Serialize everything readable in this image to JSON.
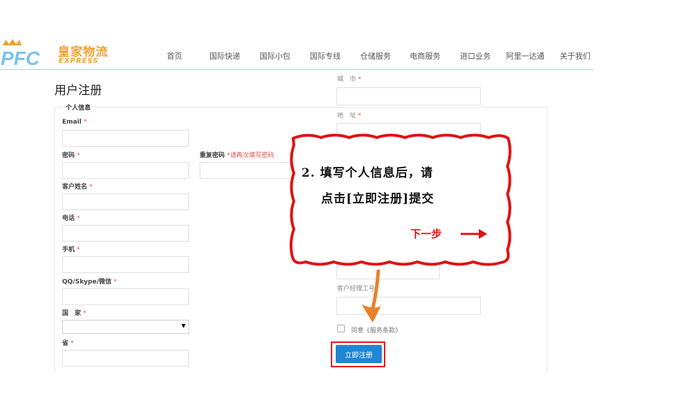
{
  "header": {
    "logo_mark": "PFC",
    "logo_text": "皇家物流",
    "logo_sub": "EXPRESS",
    "nav": [
      "首页",
      "国际快递",
      "国际小包",
      "国际专线",
      "仓储服务",
      "电商服务",
      "进口业务",
      "阿里一达通",
      "关于我们"
    ]
  },
  "page": {
    "title": "用户注册",
    "section_title": "个人信息"
  },
  "form": {
    "required_mark": "*",
    "email_label": "Email",
    "password_label": "密码",
    "confirm_password_label": "重复密码",
    "confirm_password_hint": "*请再次填写密码",
    "name_label": "客户姓名",
    "phone_label": "电话",
    "mobile_label": "手机",
    "im_label": "QQ/Skype/微信",
    "country_label": "国　家",
    "province_label": "省",
    "city_label": "城　市",
    "address_label": "地　址",
    "manager_label": "客户经理工号",
    "agree_text": "同意《服务条款》",
    "submit_label": "立即注册"
  },
  "callout": {
    "line1": "2. 填写个人信息后，请",
    "line2": "点击[立即注册]提交",
    "next": "下一步"
  },
  "colors": {
    "accent": "#f0a030",
    "logo_blue": "#7cc3ea",
    "primary_button": "#1f86d2",
    "highlight_red": "#e11111",
    "arrow_orange": "#e8822a",
    "required": "#d9534f"
  }
}
